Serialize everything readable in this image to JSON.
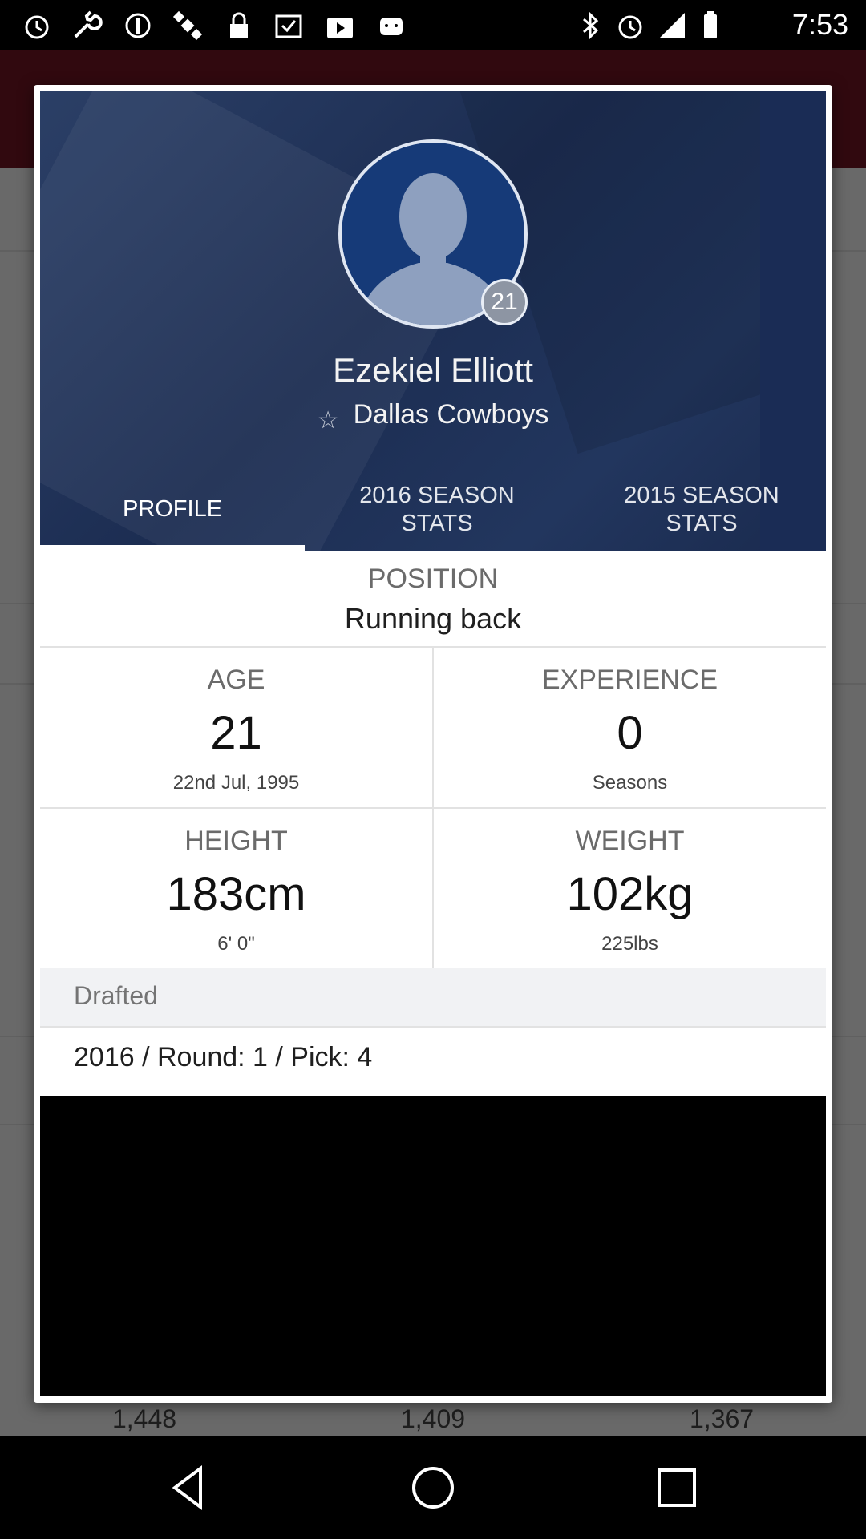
{
  "status_bar": {
    "time": "7:53",
    "left_icons": [
      "alarm-icon",
      "wrench-icon",
      "do-not-disturb-icon",
      "satellite-icon",
      "lock-icon",
      "inbox-check-icon",
      "play-store-icon",
      "android-icon"
    ],
    "right_icons": [
      "bluetooth-icon",
      "alarm-icon"
    ]
  },
  "player": {
    "name": "Ezekiel Elliott",
    "team": "Dallas Cowboys",
    "jersey_number": "21"
  },
  "tabs": [
    {
      "label": "PROFILE",
      "active": true
    },
    {
      "label": "2016 SEASON STATS",
      "active": false
    },
    {
      "label": "2015 SEASON STATS",
      "active": false
    }
  ],
  "profile": {
    "position_label": "POSITION",
    "position_value": "Running back",
    "age_label": "AGE",
    "age_value": "21",
    "age_sub": "22nd Jul, 1995",
    "experience_label": "EXPERIENCE",
    "experience_value": "0",
    "experience_sub": "Seasons",
    "height_label": "HEIGHT",
    "height_value": "183cm",
    "height_sub": "6' 0\"",
    "weight_label": "WEIGHT",
    "weight_value": "102kg",
    "weight_sub": "225lbs",
    "drafted_label": "Drafted",
    "drafted_value": "2016 / Round: 1 / Pick: 4"
  },
  "background_values": [
    "1,448",
    "1,409",
    "1,367"
  ],
  "colors": {
    "hero": "#1c2d52",
    "header_behind": "#6e1622"
  }
}
